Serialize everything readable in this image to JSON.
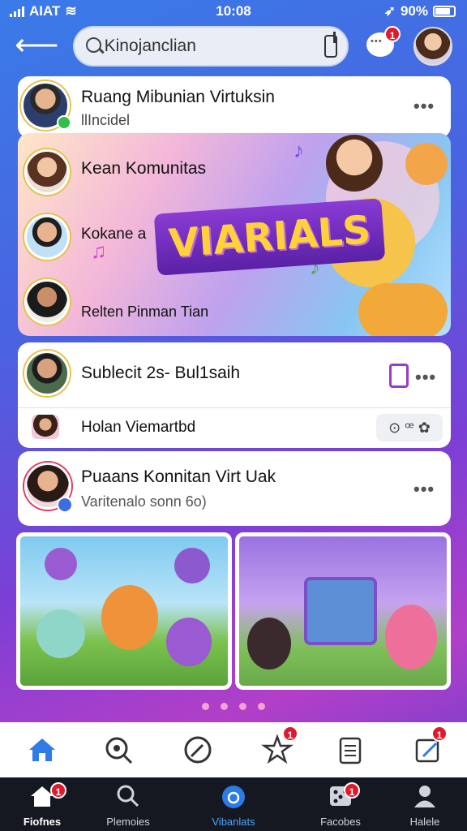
{
  "status_bar": {
    "carrier": "AIAT",
    "time": "10:08",
    "battery": "90%"
  },
  "search": {
    "placeholder": "Kinojanclian",
    "value": "Kinojanclian"
  },
  "top_badges": {
    "chat": "1"
  },
  "cards": [
    {
      "name": "Ruang Mibunian Virtuksin",
      "sub": "llIncidel"
    },
    {
      "name": "Kean Komunitas"
    },
    {
      "name": "Kokane a"
    },
    {
      "name": "Relten Pinman Tian"
    },
    {
      "name": "Sublecit 2s- Bul1saih"
    },
    {
      "name": "Holan Viemartbd"
    },
    {
      "name": "Puaans Konnitan Virt Uak",
      "sub": "Varitenalo sonn 6o)"
    }
  ],
  "banner": {
    "logo_text": "VIARIALS"
  },
  "bottom_nav": {
    "labels": [
      "Fiofnes",
      "Plemoies",
      "Vibanlats",
      "Facobes",
      "Halele"
    ],
    "badges": [
      "1",
      "1"
    ]
  },
  "top_nav_badges": [
    "1",
    "1"
  ],
  "colors": {
    "accent": "#1a73e8",
    "badge": "#e0192b",
    "background_start": "#3a7be8",
    "background_end": "#b23fc8"
  },
  "icons": [
    "back-arrow-icon",
    "search-icon",
    "share-icon",
    "chat-icon",
    "more-icon",
    "home-icon",
    "explore-icon",
    "compass-icon",
    "star-icon",
    "clipboard-icon",
    "edit-icon"
  ]
}
